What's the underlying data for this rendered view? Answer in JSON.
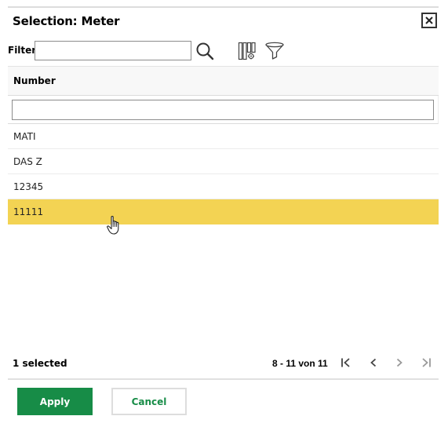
{
  "dialog": {
    "title": "Selection: Meter",
    "close_icon": "close-icon"
  },
  "toolbar": {
    "filter_label": "Filter",
    "filter_value": "",
    "filter_placeholder": "",
    "search_icon": "search-icon",
    "columns_settings_icon": "column-settings-icon",
    "filter_icon": "funnel-icon"
  },
  "table": {
    "columns": [
      {
        "label": "Number",
        "filter_value": ""
      }
    ],
    "rows": [
      {
        "number": "MATI",
        "selected": false
      },
      {
        "number": "DAS Z",
        "selected": false
      },
      {
        "number": "12345",
        "selected": false
      },
      {
        "number": "11111",
        "selected": true
      }
    ],
    "selected_row_color": "#f3d353"
  },
  "footer": {
    "selection_status": "1 selected",
    "pagination": {
      "range_text": "8 - 11 von 11",
      "first_icon": "first-page-icon",
      "prev_icon": "previous-page-icon",
      "next_icon": "next-page-icon",
      "last_icon": "last-page-icon"
    }
  },
  "actions": {
    "apply_label": "Apply",
    "cancel_label": "Cancel",
    "primary_color": "#178c47"
  }
}
